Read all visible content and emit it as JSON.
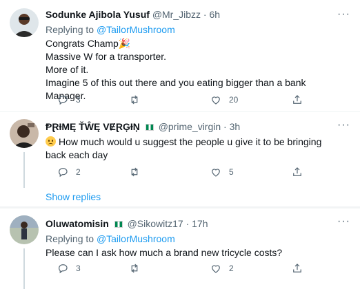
{
  "tweets": [
    {
      "name": "Sodunke Ajibola Yusuf",
      "handle": "@Mr_Jibzz",
      "time": "6h",
      "replying_label": "Replying to",
      "replying_to": "@TailorMushroom",
      "lines": [
        "Congrats Champ🎉",
        "Massive W for a transporter.",
        "More of it.",
        "Imagine 5 of this out there and you eating bigger than a bank Manager."
      ],
      "replies": "3",
      "retweets": "",
      "likes": "20"
    },
    {
      "name": "ⱣⱤƗMĘ ŤŴĘ VɆⱤĢƗŅ",
      "handle": "@prime_virgin",
      "time": "3h",
      "text": "How much would u suggest the people u give it to be bringing back each day",
      "replies": "2",
      "retweets": "",
      "likes": "5"
    },
    {
      "name": "Oluwatomisin",
      "handle": "@Sikowitz17",
      "time": "17h",
      "replying_label": "Replying to",
      "replying_to": "@TailorMushroom",
      "text": "Please can I ask how much a brand new tricycle costs?",
      "replies": "3",
      "retweets": "",
      "likes": "2"
    }
  ],
  "show_replies": "Show replies",
  "separator": "·",
  "icons": [
    "reply-icon",
    "retweet-icon",
    "like-icon",
    "share-icon",
    "more-icon",
    "nigeria-flag-icon",
    "frowning-face-icon"
  ],
  "colors": {
    "accent": "#1d9bf0",
    "muted": "#536471",
    "text": "#0f1419"
  }
}
